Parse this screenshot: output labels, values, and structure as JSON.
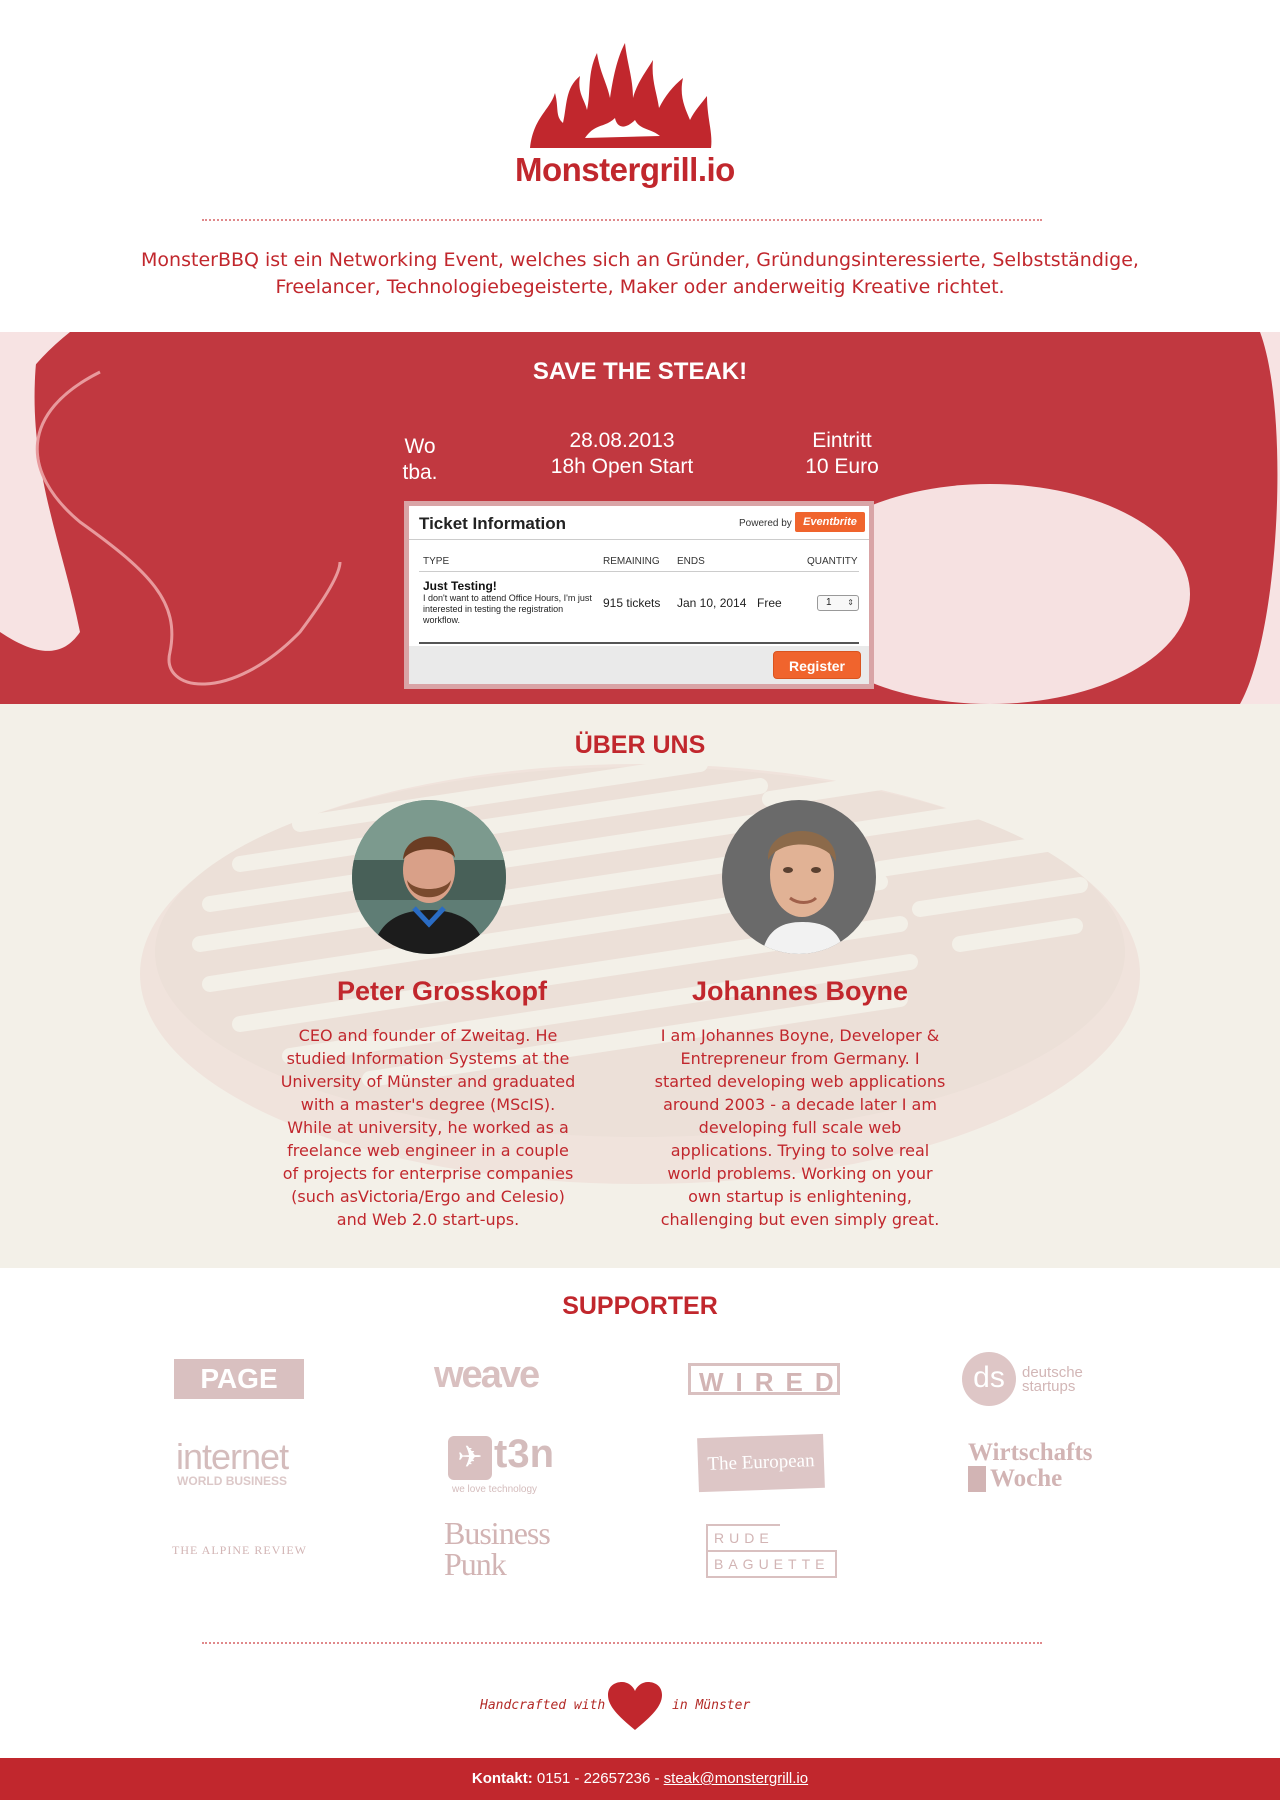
{
  "brand": {
    "name": "Monstergrill.io"
  },
  "intro": {
    "text": "MonsterBBQ ist ein Networking Event, welches sich an Gründer, Gründungsinteressierte, Selbstständige, Freelancer, Technologiebegeisterte, Maker oder anderweitig Kreative richtet."
  },
  "event": {
    "title": "SAVE THE STEAK!",
    "where_label": "Wo",
    "where_value": "tba.",
    "date": "28.08.2013",
    "time": "18h Open Start",
    "entry_label": "Eintritt",
    "entry_value": "10 Euro"
  },
  "ticket": {
    "title": "Ticket Information",
    "powered_by": "Powered by",
    "provider": "Eventbrite",
    "headers": {
      "type": "TYPE",
      "remaining": "REMAINING",
      "ends": "ENDS",
      "quantity": "QUANTITY"
    },
    "row": {
      "name": "Just Testing!",
      "description": "I don't want to attend Office Hours, I'm just interested in testing the registration workflow.",
      "remaining": "915 tickets",
      "ends": "Jan 10, 2014",
      "price": "Free",
      "quantity": "1"
    },
    "register_label": "Register"
  },
  "about": {
    "title": "ÜBER UNS",
    "people": [
      {
        "name": "Peter Grosskopf",
        "bio": "CEO and founder of Zweitag. He studied Information Systems at the University of Münster and graduated with a master's degree (MScIS). While at university, he worked as a freelance web engineer in a couple of projects for enterprise companies (such asVictoria/Ergo and Celesio) and Web 2.0 start-ups."
      },
      {
        "name": "Johannes Boyne",
        "bio": "I am Johannes Boyne, Developer & Entrepreneur from Germany. I started developing web applications around 2003 - a decade later I am developing full scale web applications. Trying to solve real world problems. Working on your own startup is enlightening, challenging but even simply great."
      }
    ]
  },
  "supporter": {
    "title": "SUPPORTER",
    "logos": {
      "page": "PAGE",
      "weave": "weave",
      "wired": "WIRED",
      "ds_mark": "ds",
      "ds_line1": "deutsche",
      "ds_line2": "startups",
      "iwb_line1": "internet",
      "iwb_line2": "WORLD BUSINESS",
      "t3n": "t3n",
      "t3n_tagline": "we love technology",
      "european": "The European",
      "ww_line1": "Wirtschafts",
      "ww_line2": "Woche",
      "alpine": "THE ALPINE REVIEW",
      "bp_line1": "Business",
      "bp_line2": "Punk",
      "rb_line1": "RUDE",
      "rb_line2": "BAGUETTE"
    }
  },
  "footer": {
    "handcrafted_before": "Handcrafted with",
    "handcrafted_after": "in Münster",
    "contact_label": "Kontakt:",
    "phone": "0151 - 22657236",
    "separator": "-",
    "email": "steak@monstergrill.io"
  },
  "colors": {
    "brand_red": "#c1272d",
    "beige": "#f3f0e8",
    "eventbrite_orange": "#f0642d"
  }
}
